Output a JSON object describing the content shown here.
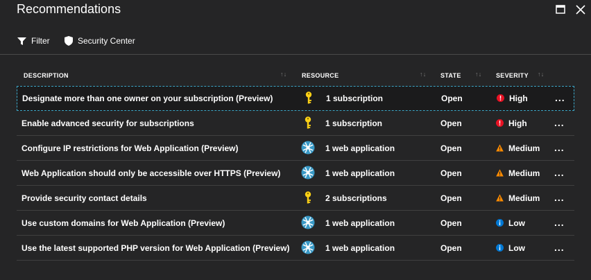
{
  "window": {
    "title": "Recommendations"
  },
  "toolbar": {
    "filter_label": "Filter",
    "security_center_label": "Security Center"
  },
  "table": {
    "headers": {
      "description": "DESCRIPTION",
      "resource": "RESOURCE",
      "state": "STATE",
      "severity": "SEVERITY"
    },
    "sort_glyph": "↑↓",
    "more_glyph": "...",
    "rows": [
      {
        "description": "Designate more than one owner on your subscription (Preview)",
        "resource_icon": "key-icon",
        "resource": "1 subscription",
        "state": "Open",
        "severity_icon": "error-icon",
        "severity": "High",
        "selected": true
      },
      {
        "description": "Enable advanced security for subscriptions",
        "resource_icon": "key-icon",
        "resource": "1 subscription",
        "state": "Open",
        "severity_icon": "error-icon",
        "severity": "High"
      },
      {
        "description": "Configure IP restrictions for Web Application (Preview)",
        "resource_icon": "web-app-icon",
        "resource": "1 web application",
        "state": "Open",
        "severity_icon": "warning-icon",
        "severity": "Medium"
      },
      {
        "description": "Web Application should only be accessible over HTTPS (Preview)",
        "resource_icon": "web-app-icon",
        "resource": "1 web application",
        "state": "Open",
        "severity_icon": "warning-icon",
        "severity": "Medium"
      },
      {
        "description": "Provide security contact details",
        "resource_icon": "key-icon",
        "resource": "2 subscriptions",
        "state": "Open",
        "severity_icon": "warning-icon",
        "severity": "Medium"
      },
      {
        "description": "Use custom domains for Web Application (Preview)",
        "resource_icon": "web-app-icon",
        "resource": "1 web application",
        "state": "Open",
        "severity_icon": "info-icon",
        "severity": "Low"
      },
      {
        "description": "Use the latest supported PHP version for Web Application (Preview)",
        "resource_icon": "web-app-icon",
        "resource": "1 web application",
        "state": "Open",
        "severity_icon": "info-icon",
        "severity": "Low"
      }
    ]
  },
  "colors": {
    "background": "#252526",
    "selection_border": "#3ca6c7",
    "high": "#e81123",
    "medium": "#ff8c00",
    "low": "#0078d4",
    "key": "#fcd116",
    "web_app": "#3999c6"
  }
}
